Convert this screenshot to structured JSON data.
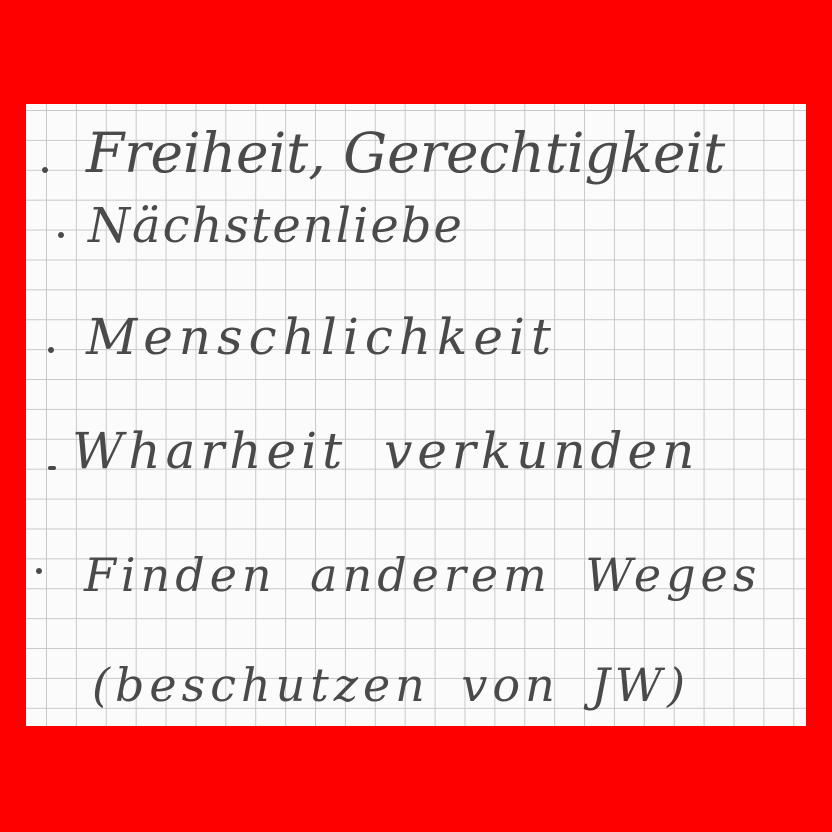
{
  "colors": {
    "border": "#ff0000",
    "paper": "#fbfbfb",
    "grid": "#c9c9c9",
    "ink": "#4a4a4a"
  },
  "notes": {
    "lines": [
      {
        "bullet": true,
        "text": "Freiheit, Gerechtigkeit"
      },
      {
        "bullet": true,
        "text": "Nächstenliebe"
      },
      {
        "bullet": true,
        "text": "Menschlichkeit"
      },
      {
        "bullet": true,
        "text": "Wharheit verkunden"
      },
      {
        "bullet": true,
        "text": "Finden anderem Weges"
      },
      {
        "bullet": false,
        "text": "(beschutzen von JW)"
      }
    ]
  }
}
